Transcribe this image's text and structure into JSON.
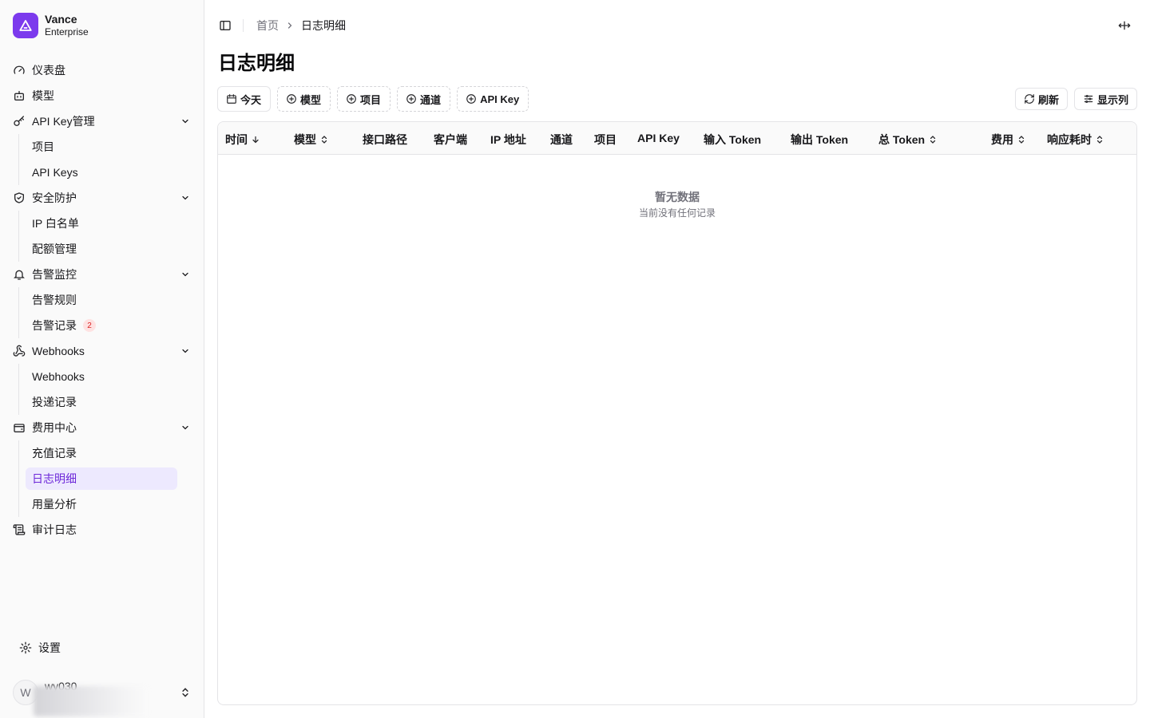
{
  "brand": {
    "name": "Vance",
    "subtitle": "Enterprise"
  },
  "sidebar": {
    "items": [
      {
        "label": "仪表盘",
        "icon": "gauge-icon"
      },
      {
        "label": "模型",
        "icon": "bot-icon"
      },
      {
        "label": "API Key管理",
        "icon": "key-icon",
        "children": [
          "项目",
          "API Keys"
        ]
      },
      {
        "label": "安全防护",
        "icon": "shield-check-icon",
        "children": [
          "IP 白名单",
          "配额管理"
        ]
      },
      {
        "label": "告警监控",
        "icon": "bell-icon",
        "children": [
          "告警规则",
          "告警记录"
        ],
        "badge": "2"
      },
      {
        "label": "Webhooks",
        "icon": "webhook-icon",
        "children": [
          "Webhooks",
          "投递记录"
        ]
      },
      {
        "label": "费用中心",
        "icon": "wallet-icon",
        "children": [
          "充值记录",
          "日志明细",
          "用量分析"
        ],
        "active_child": "日志明细"
      },
      {
        "label": "审计日志",
        "icon": "scroll-icon"
      }
    ],
    "settings_label": "设置",
    "user": {
      "avatar_letter": "W",
      "name": "wy030"
    }
  },
  "breadcrumb": {
    "home": "首页",
    "current": "日志明细"
  },
  "page": {
    "title": "日志明细"
  },
  "filters": [
    {
      "label": "今天",
      "icon": "calendar-icon"
    },
    {
      "label": "模型",
      "icon": "plus-circle-icon"
    },
    {
      "label": "项目",
      "icon": "plus-circle-icon"
    },
    {
      "label": "通道",
      "icon": "plus-circle-icon"
    },
    {
      "label": "API Key",
      "icon": "plus-circle-icon"
    }
  ],
  "actions": {
    "refresh": "刷新",
    "columns": "显示列"
  },
  "table": {
    "columns": [
      "时间",
      "模型",
      "接口路径",
      "客户端",
      "IP 地址",
      "通道",
      "项目",
      "API Key",
      "输入 Token",
      "输出 Token",
      "总 Token",
      "费用",
      "响应耗时"
    ],
    "empty_title": "暂无数据",
    "empty_subtitle": "当前没有任何记录"
  },
  "colors": {
    "accent": "#7c3aed",
    "active_bg": "#ede9fe",
    "badge_bg": "#fee2e2",
    "badge_fg": "#dc2626"
  }
}
